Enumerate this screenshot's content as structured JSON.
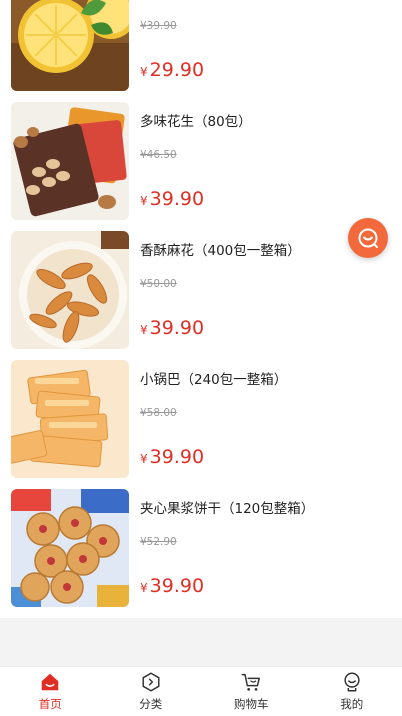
{
  "products": [
    {
      "title": "",
      "old_price": "¥39.90",
      "currency": "¥",
      "price": "29.90",
      "image": "lemon-slice-image"
    },
    {
      "title": "多味花生（80包）",
      "old_price": "¥46.50",
      "currency": "¥",
      "price": "39.90",
      "image": "peanut-snack-image"
    },
    {
      "title": "香酥麻花（400包一整箱）",
      "old_price": "¥50.00",
      "currency": "¥",
      "price": "39.90",
      "image": "mahua-twist-image"
    },
    {
      "title": "小锅巴（240包一整箱）",
      "old_price": "¥58.00",
      "currency": "¥",
      "price": "39.90",
      "image": "rice-crust-image"
    },
    {
      "title": "夹心果浆饼干（120包整箱）",
      "old_price": "¥52.90",
      "currency": "¥",
      "price": "39.90",
      "image": "jam-biscuit-image"
    }
  ],
  "float_button": {
    "icon": "customer-service-icon",
    "color": "#f26a3c"
  },
  "tabbar": {
    "active_color": "#e02e24",
    "items": [
      {
        "label": "首页",
        "icon": "home-icon",
        "active": true
      },
      {
        "label": "分类",
        "icon": "category-icon",
        "active": false
      },
      {
        "label": "购物车",
        "icon": "cart-icon",
        "active": false
      },
      {
        "label": "我的",
        "icon": "profile-icon",
        "active": false
      }
    ]
  }
}
